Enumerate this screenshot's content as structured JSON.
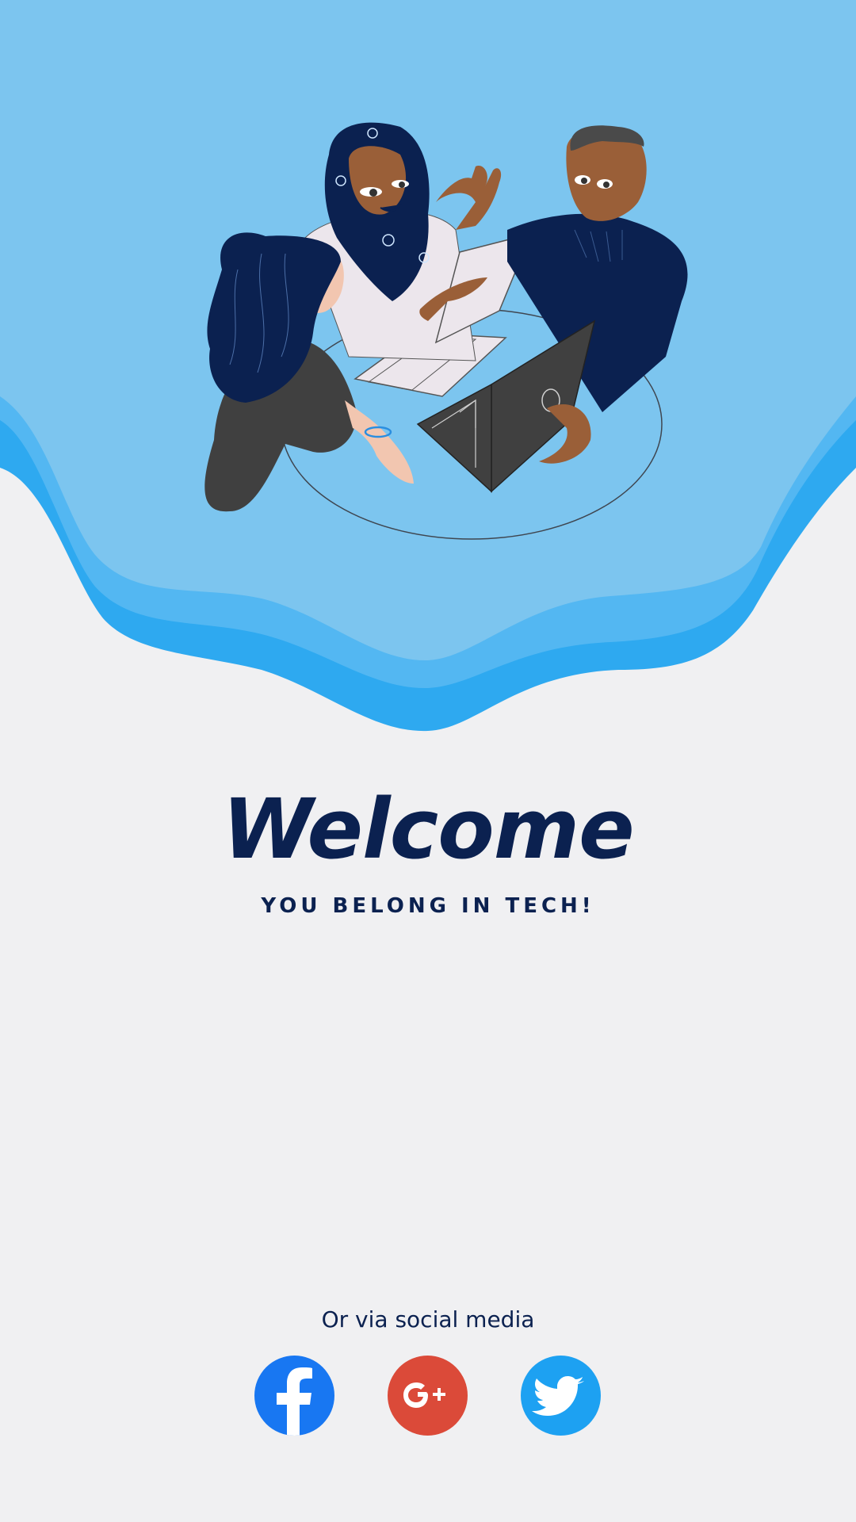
{
  "welcome": {
    "title": "Welcome",
    "subtitle": "YOU BELONG IN TECH!"
  },
  "social": {
    "caption": "Or via social media",
    "buttons": [
      {
        "name": "facebook",
        "icon": "facebook-icon",
        "color": "#1877f2"
      },
      {
        "name": "google-plus",
        "icon": "google-plus-icon",
        "color": "#db4a39"
      },
      {
        "name": "twitter",
        "icon": "twitter-icon",
        "color": "#1da1f2"
      }
    ]
  },
  "colors": {
    "background": "#f0f0f2",
    "hero_sky": "#7cc5ef",
    "wave_mid": "#53b7f2",
    "wave_dark": "#2ea9f0",
    "navy": "#0b2150"
  }
}
